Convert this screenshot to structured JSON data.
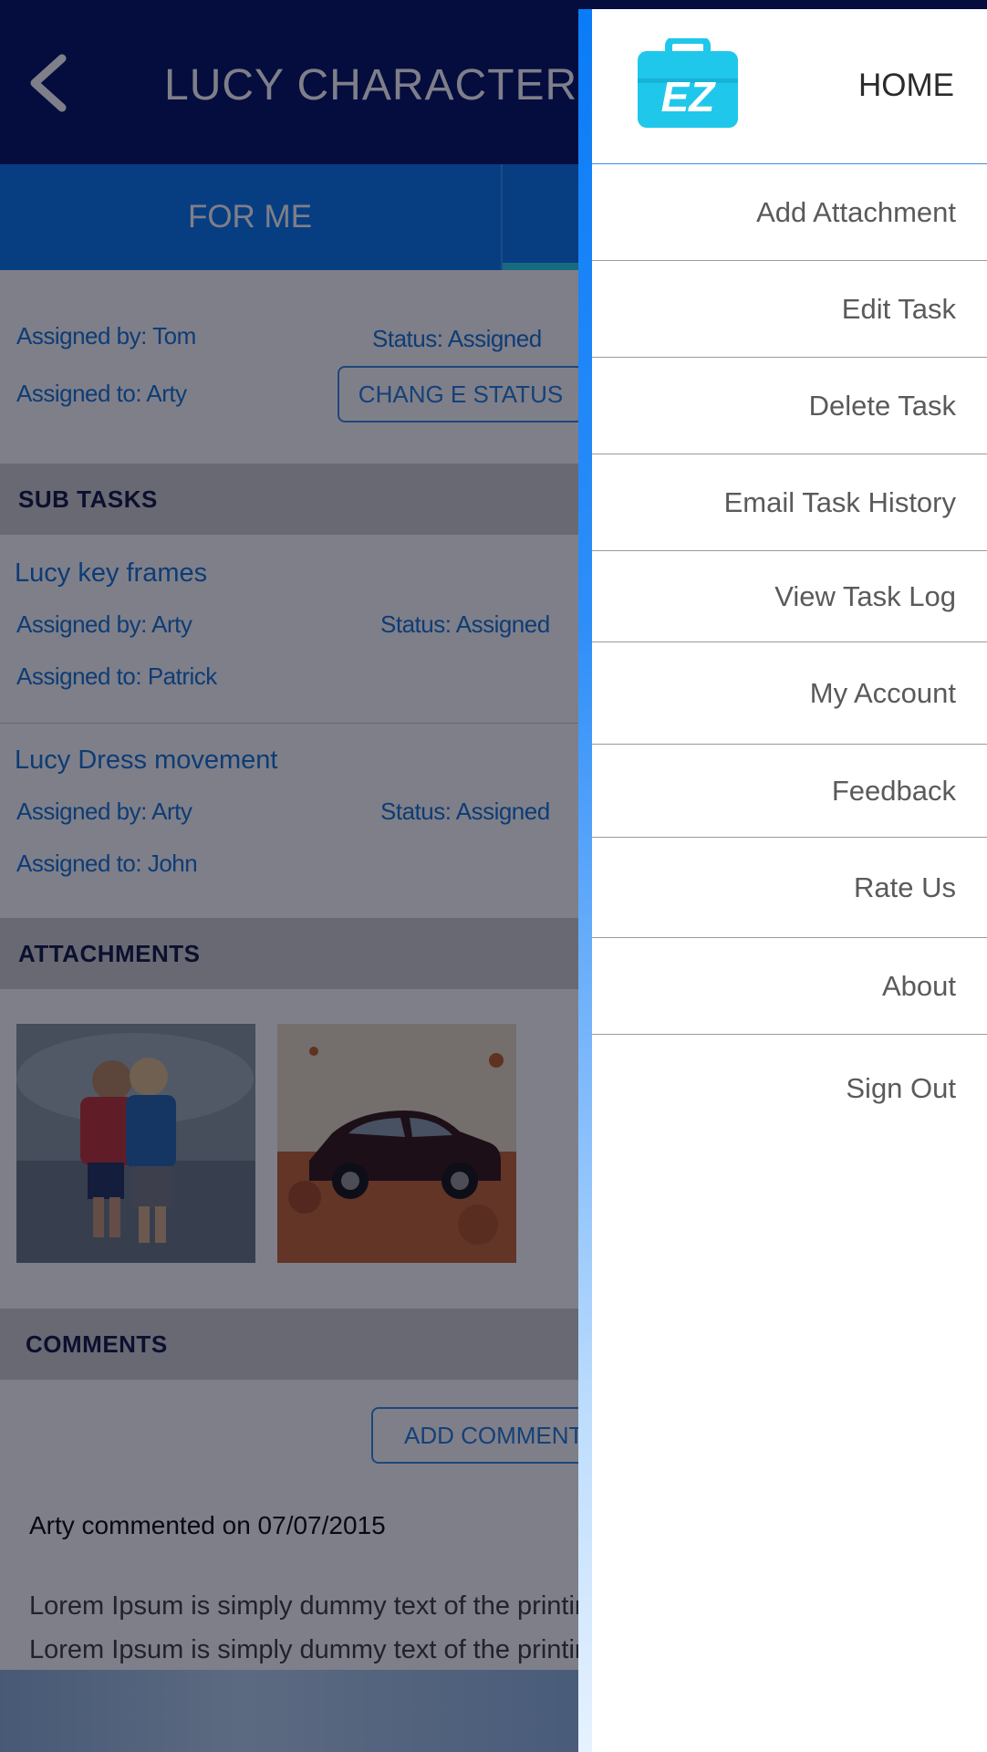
{
  "header": {
    "title": "LUCY CHARACTER",
    "back_icon": "chevron-left-icon"
  },
  "tabs": [
    {
      "label": "FOR ME"
    }
  ],
  "task": {
    "assigned_by": "Assigned by: Tom",
    "status": "Status: Assigned",
    "assigned_to": "Assigned to: Arty",
    "change_status_label": "CHANG E STATUS"
  },
  "subtasks_section": {
    "label": "SUB TASKS"
  },
  "subtasks": [
    {
      "title": "Lucy key frames",
      "assigned_by": "Assigned by: Arty",
      "status": "Status: Assigned",
      "assigned_to": "Assigned to: Patrick"
    },
    {
      "title": "Lucy Dress movement",
      "assigned_by": "Assigned by: Arty",
      "status": "Status: Assigned",
      "assigned_to": "Assigned to: John"
    }
  ],
  "attachments_section": {
    "label": "ATTACHMENTS"
  },
  "attachments": [
    {
      "kind": "photo of two children hugging in water"
    },
    {
      "kind": "photo of dark SUV on autumn leaves"
    }
  ],
  "comments_section": {
    "label": "COMMENTS",
    "add_label": "ADD COMMENT"
  },
  "comments": [
    {
      "header": "Arty commented on 07/07/2015",
      "lines": [
        "Lorem Ipsum is simply dummy text of the printing",
        "Lorem Ipsum is simply dummy text of the printing"
      ]
    }
  ],
  "drawer": {
    "logo_text": "EZ",
    "home_label": "HOME",
    "items": [
      {
        "label": "Add Attachment"
      },
      {
        "label": "Edit Task"
      },
      {
        "label": "Delete Task"
      },
      {
        "label": "Email Task History"
      },
      {
        "label": "View Task Log"
      },
      {
        "label": "My Account"
      },
      {
        "label": "Feedback"
      },
      {
        "label": "Rate Us"
      },
      {
        "label": "About"
      },
      {
        "label": "Sign Out"
      }
    ]
  },
  "colors": {
    "header": "#0a1a6a",
    "tabs": "#0f7df0",
    "accent": "#1b78d6",
    "tab_indicator": "#2fd7e8",
    "logo": "#1fc8ea"
  }
}
